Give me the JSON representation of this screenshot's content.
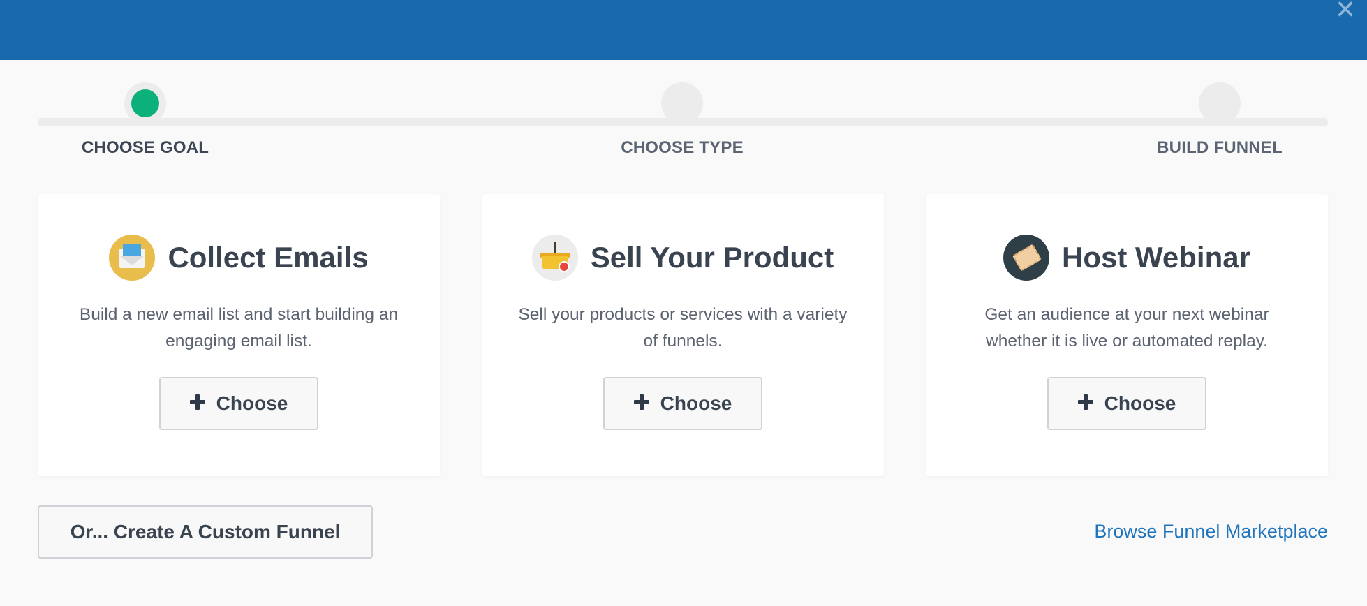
{
  "header": {
    "close_label": "×"
  },
  "steps": [
    {
      "label": "CHOOSE GOAL",
      "active": true
    },
    {
      "label": "CHOOSE TYPE",
      "active": false
    },
    {
      "label": "BUILD FUNNEL",
      "active": false
    }
  ],
  "cards": [
    {
      "title": "Collect Emails",
      "description": "Build a new email list and start building an engaging email list.",
      "icon": "email-envelope-icon",
      "button_label": "Choose"
    },
    {
      "title": "Sell Your Product",
      "description": "Sell your products or services with a variety of funnels.",
      "icon": "shopping-basket-icon",
      "button_label": "Choose"
    },
    {
      "title": "Host Webinar",
      "description": "Get an audience at your next webinar whether it is live or automated replay.",
      "icon": "ticket-icon",
      "button_label": "Choose"
    }
  ],
  "footer": {
    "custom_funnel_label": "Or... Create A Custom Funnel",
    "marketplace_link": "Browse Funnel Marketplace"
  },
  "colors": {
    "header_blue": "#186aad",
    "active_step": "#0bb07b",
    "link_blue": "#1f75bd"
  }
}
